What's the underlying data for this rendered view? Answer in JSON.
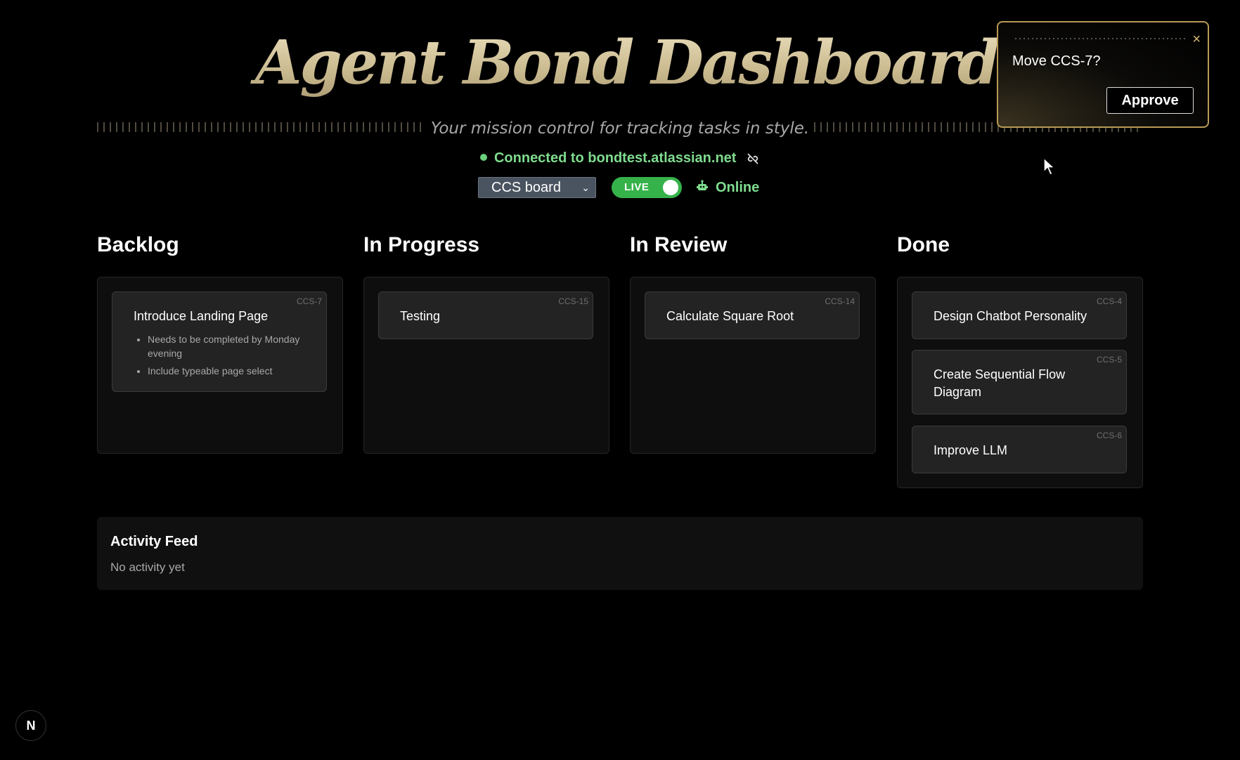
{
  "header": {
    "title": "Agent Bond Dashboard",
    "subtitle": "Your mission control for tracking tasks in style.",
    "connection_text": "Connected to bondtest.atlassian.net",
    "board_select_value": "CCS board",
    "live_label": "LIVE",
    "live_enabled": true,
    "status_text": "Online"
  },
  "toast": {
    "message": "Move CCS-7?",
    "approve_label": "Approve",
    "close_glyph": "×"
  },
  "columns": [
    {
      "title": "Backlog",
      "cards": [
        {
          "key": "CCS-7",
          "title": "Introduce Landing Page",
          "bullets": [
            "Needs to be completed by Monday evening",
            "Include typeable page select"
          ]
        }
      ]
    },
    {
      "title": "In Progress",
      "cards": [
        {
          "key": "CCS-15",
          "title": "Testing"
        }
      ]
    },
    {
      "title": "In Review",
      "cards": [
        {
          "key": "CCS-14",
          "title": "Calculate Square Root"
        }
      ]
    },
    {
      "title": "Done",
      "cards": [
        {
          "key": "CCS-4",
          "title": "Design Chatbot Personality"
        },
        {
          "key": "CCS-5",
          "title": "Create Sequential Flow Diagram"
        },
        {
          "key": "CCS-6",
          "title": "Improve LLM"
        }
      ]
    }
  ],
  "activity": {
    "title": "Activity Feed",
    "empty_text": "No activity yet"
  },
  "footer": {
    "badge_letter": "N"
  },
  "colors": {
    "background": "#000000",
    "accent_gold": "#b89a55",
    "status_green": "#7fdc8e",
    "toggle_green": "#36b24a"
  },
  "icons": {
    "connection": "status-dot-icon",
    "unlink": "unlink-icon",
    "online": "robot-icon",
    "close": "close-icon"
  }
}
